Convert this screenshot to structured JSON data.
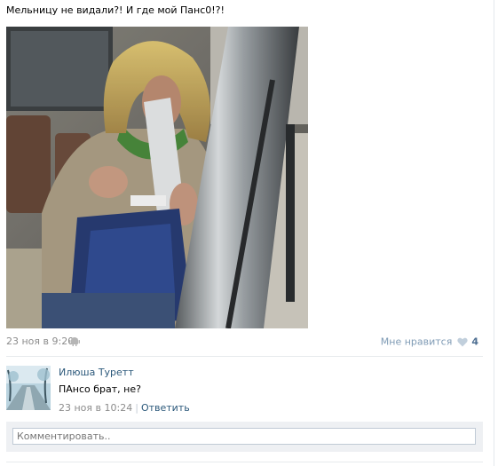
{
  "post": {
    "text": "Мельницу не видали?! И где мой Панс0!?!",
    "date": "23 ноя в 9:20",
    "platform_icon": "android-icon"
  },
  "likes": {
    "label": "Мне нравится",
    "count": "4",
    "icon": "heart-icon"
  },
  "comments": [
    {
      "author": "Илюша Туретт",
      "text": "ПАнсо брат, не?",
      "date": "23 ноя в 10:24",
      "separator": "|",
      "reply_label": "Ответить"
    }
  ],
  "reply": {
    "placeholder": "Комментировать.."
  },
  "colors": {
    "link": "#2b587a",
    "meta": "#8c8c8c",
    "like_label": "#7f9bb5",
    "reply_area": "#eef0f3"
  }
}
